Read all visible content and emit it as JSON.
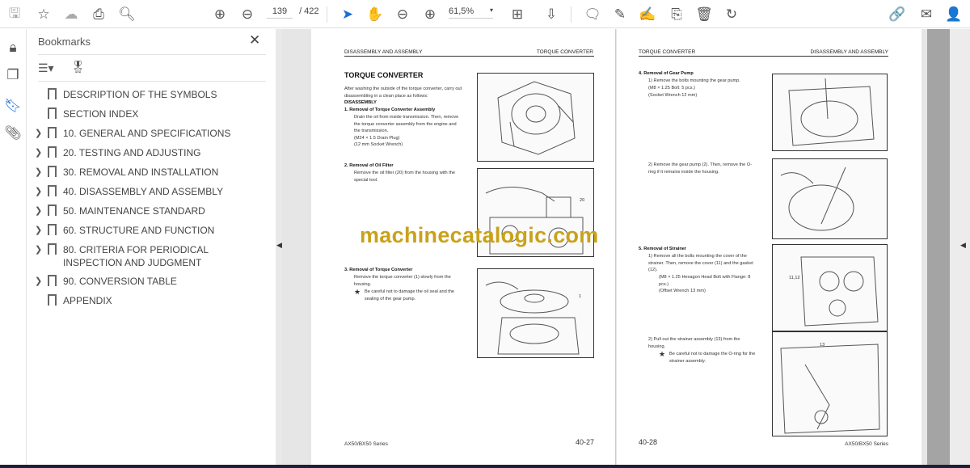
{
  "toolbar": {
    "page_current": "139",
    "page_total": "/ 422",
    "zoom": "61,5%",
    "icons": [
      "save-icon",
      "bookmark-star-icon",
      "cloud-upload-icon",
      "print-icon",
      "zoom-search-icon",
      "page-up-icon",
      "page-down-icon",
      "select-cursor-icon",
      "hand-icon",
      "zoom-out-icon",
      "zoom-in-icon",
      "page-fit-icon",
      "scroll-mode-icon",
      "comment-icon",
      "highlight-icon",
      "sign-icon",
      "extract-icon",
      "delete-icon",
      "rotate-icon",
      "share-link-icon",
      "email-icon",
      "add-user-icon"
    ]
  },
  "panel": {
    "title": "Bookmarks",
    "bookmarks": [
      {
        "label": "DESCRIPTION OF THE SYMBOLS",
        "expandable": false
      },
      {
        "label": "SECTION INDEX",
        "expandable": false
      },
      {
        "label": "10. GENERAL AND SPECIFICATIONS",
        "expandable": true
      },
      {
        "label": "20. TESTING AND ADJUSTING",
        "expandable": true
      },
      {
        "label": "30. REMOVAL AND INSTALLATION",
        "expandable": true
      },
      {
        "label": "40. DISASSEMBLY AND ASSEMBLY",
        "expandable": true
      },
      {
        "label": "50. MAINTENANCE STANDARD",
        "expandable": true
      },
      {
        "label": "60. STRUCTURE AND FUNCTION",
        "expandable": true
      },
      {
        "label": "80. CRITERIA FOR PERIODICAL INSPECTION AND JUDGMENT",
        "expandable": true
      },
      {
        "label": "90. CONVERSION TABLE",
        "expandable": true
      },
      {
        "label": "APPENDIX",
        "expandable": false
      }
    ]
  },
  "left_page": {
    "header_left": "DISASSEMBLY AND ASSEMBLY",
    "header_right": "TORQUE CONVERTER",
    "title": "TORQUE CONVERTER",
    "intro": "After washing the outside of the torque converter, carry out disassembling in a clean place as follows:",
    "section": "DISASSEMBLY",
    "s1_title": "1.   Removal of Torque Converter Assembly",
    "s1_text": "Drain the oil from inside transmission. Then, remove the torque converter assembly from the engine and the transmission.",
    "s1_l1": "(M24 × 1.5 Drain Plug)",
    "s1_l2": "(12 mm Socket Wrench)",
    "s2_title": "2.   Removal of Oil Filter",
    "s2_text": "Remove the oil filter (20) from the housing with the special tool.",
    "s3_title": "3.   Removal of Torque Converter",
    "s3_text": "Remove the torque converter (1) slowly from the housing.",
    "s3_note": "Be careful not to damage the oil seal and the sealing of the gear pump.",
    "fig2_label": "20",
    "fig3_label": "1",
    "footer": "AX50/BX50 Series",
    "page_no": "40-27"
  },
  "right_page": {
    "header_left": "TORQUE CONVERTER",
    "header_right": "DISASSEMBLY AND ASSEMBLY",
    "s4_title": "4.   Removal of Gear Pump",
    "s4_1": "1)   Remove the bolts mounting the gear pump.",
    "s4_1a": "(M8 × 1.25 Bolt: 5 pcs.)",
    "s4_1b": "(Socket Wrench 12 mm)",
    "s4_2": "2)   Remove the gear pump (2). Then, remove the O-ring if it remains inside the housing.",
    "s5_title": "5.   Removal of Strainer",
    "s5_1": "1)   Remove all the bolts mounting the cover of the strainer. Then, remove the cover (11) and the gasket (12).",
    "s5_1a": "(M8 × 1.25 Hexagon Head Bolt with Flange: 8 pcs.)",
    "s5_1b": "(Offset Wrench 13 mm)",
    "s5_2": "2)   Pull out the strainer assembly (13) from the housing.",
    "s5_note": "Be careful not to damage the O-ring for the strainer assembly.",
    "fig3_label": "11,12",
    "fig4_label": "13",
    "footer": "AX50/BX50 Series",
    "page_no": "40-28"
  },
  "watermark": "machinecatalogic.com"
}
